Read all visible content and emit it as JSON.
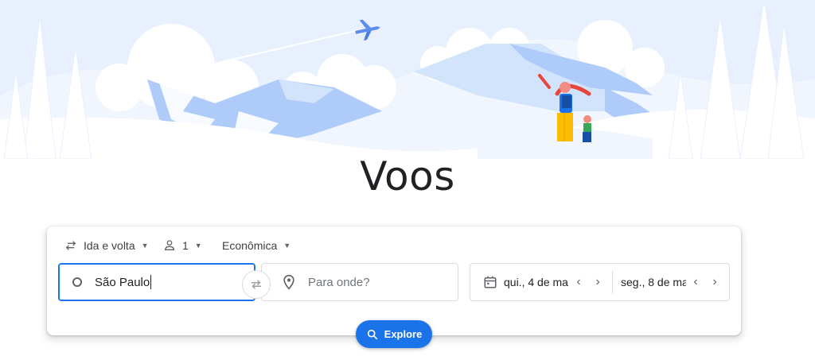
{
  "page": {
    "title": "Voos"
  },
  "trip_options": {
    "trip_type": "Ida e volta",
    "passengers": "1",
    "cabin_class": "Econômica"
  },
  "search": {
    "origin_value": "São Paulo",
    "destination_placeholder": "Para onde?",
    "depart_date": "qui., 4 de ma",
    "return_date": "seg., 8 de ma",
    "explore_label": "Explore"
  },
  "colors": {
    "accent": "#1a73e8",
    "hero_light": "#e8f0fe",
    "hero_mid": "#aecbfa"
  },
  "icons": [
    "swap-arrows-icon",
    "person-icon",
    "caret-down-icon",
    "circle-origin-icon",
    "swap-icon",
    "location-pin-icon",
    "calendar-icon",
    "chevron-left-icon",
    "chevron-right-icon",
    "search-icon",
    "airplane-icon"
  ]
}
